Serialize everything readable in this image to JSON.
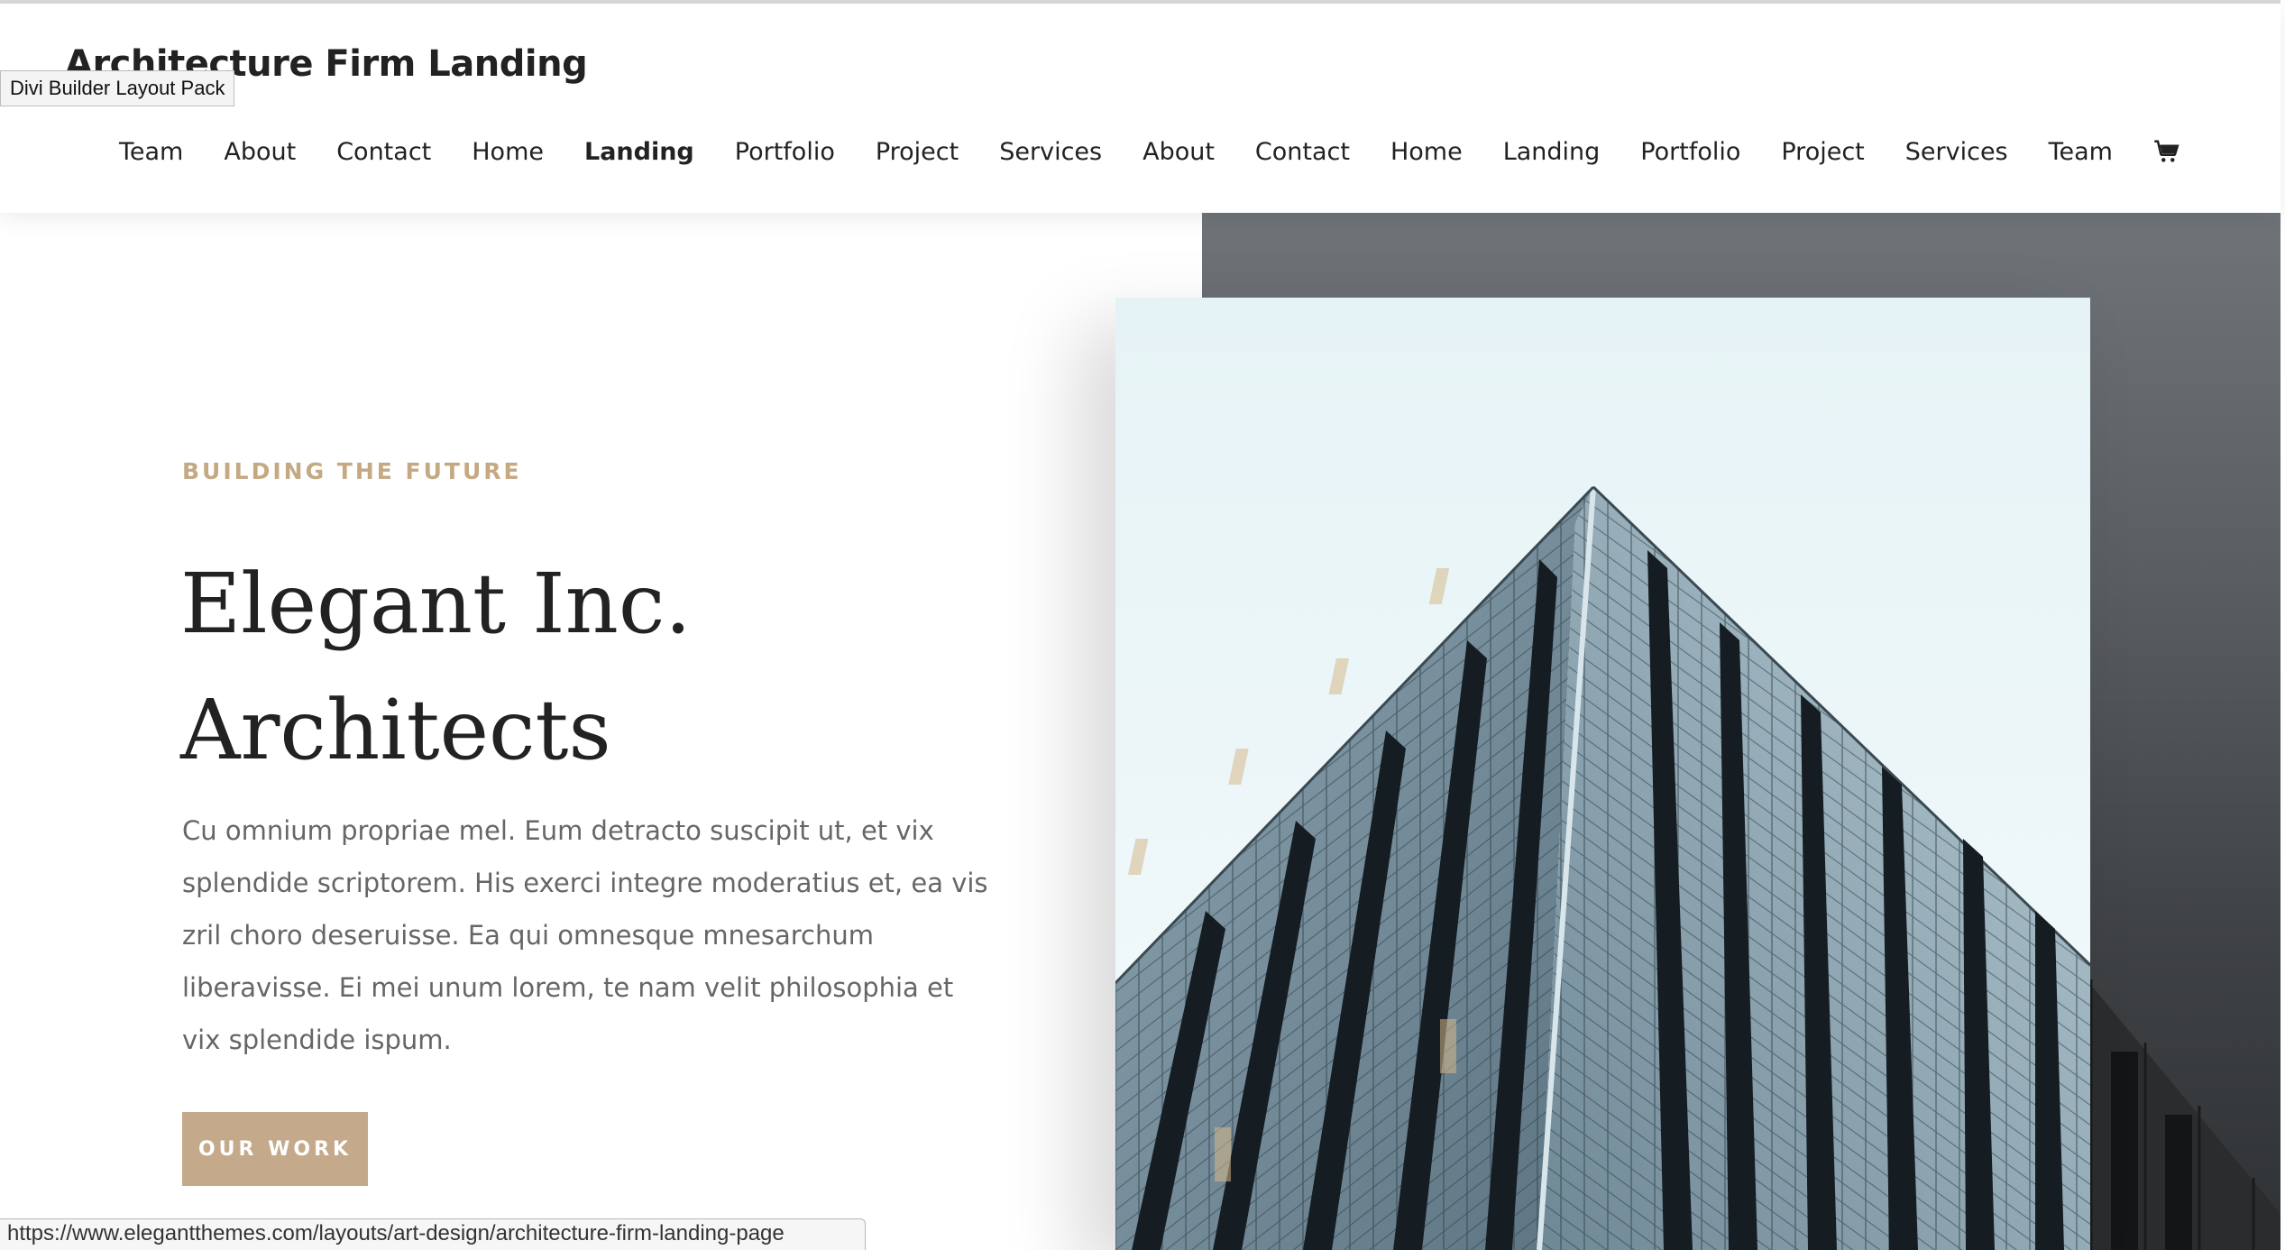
{
  "tooltip": "Divi Builder Layout Pack",
  "site": {
    "title": "Architecture Firm Landing"
  },
  "nav": {
    "items": [
      {
        "label": "Team"
      },
      {
        "label": "About"
      },
      {
        "label": "Contact"
      },
      {
        "label": "Home"
      },
      {
        "label": "Landing",
        "active": true
      },
      {
        "label": "Portfolio"
      },
      {
        "label": "Project"
      },
      {
        "label": "Services"
      },
      {
        "label": "About"
      },
      {
        "label": "Contact"
      },
      {
        "label": "Home"
      },
      {
        "label": "Landing"
      },
      {
        "label": "Portfolio"
      },
      {
        "label": "Project"
      },
      {
        "label": "Services"
      },
      {
        "label": "Team"
      }
    ],
    "cart_icon": "shopping-cart-icon"
  },
  "hero": {
    "eyebrow": "BUILDING THE FUTURE",
    "title_line1": "Elegant Inc.",
    "title_line2": "Architects",
    "body": "Cu omnium propriae mel. Eum detracto suscipit ut, et vix splendide scriptorem. His exerci integre moderatius et, ea vis zril choro deseruisse. Ea qui omnesque mnesarchum liberavisse. Ei mei unum lorem, te nam velit philosophia et vix splendide ispum.",
    "cta_label": "OUR WORK"
  },
  "status_bar": {
    "url": "https://www.elegantthemes.com/layouts/art-design/architecture-firm-landing-page"
  },
  "colors": {
    "accent": "#c4a982",
    "button": "#c4a98b",
    "text_dark": "#222222",
    "text_body": "#666666",
    "gray_panel": "#5a5e61"
  }
}
